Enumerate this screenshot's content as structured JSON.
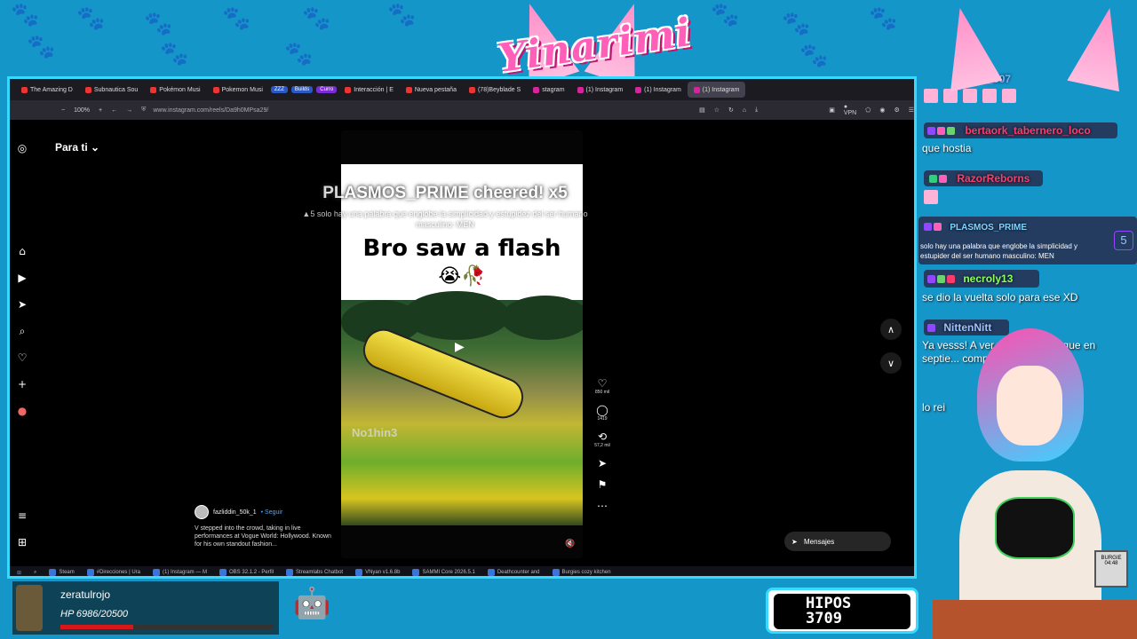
{
  "overlay": {
    "logo_text": "Yinarimi",
    "colors": {
      "background": "#1596c9",
      "frame": "#38d9ff",
      "pink": "#ff5fb8"
    }
  },
  "browser": {
    "tabs": [
      {
        "label": "The Amazing D",
        "active": false
      },
      {
        "label": "Subnautica Sou",
        "active": false
      },
      {
        "label": "Pokémon Musi",
        "active": false
      },
      {
        "label": "Pokemon Musi",
        "active": false
      },
      {
        "label": "ZZZ",
        "pill": true
      },
      {
        "label": "Builds",
        "pill": true
      },
      {
        "label": "Curro",
        "pill": true
      },
      {
        "label": "Interacción | E",
        "active": false
      },
      {
        "label": "Nueva pestaña",
        "active": false
      },
      {
        "label": "(78)Beyblade S",
        "active": false
      },
      {
        "label": "stagram",
        "active": false
      },
      {
        "label": "(1) Instagram",
        "active": false
      },
      {
        "label": "(1) Instagram",
        "active": false
      },
      {
        "label": "(1) Instagram",
        "active": true
      }
    ],
    "zoom": "100%",
    "url": "www.instagram.com/reels/Da9h0MPsa29/",
    "vpn_label": "VPN"
  },
  "instagram": {
    "feed_label": "Para ti",
    "reel": {
      "title": "Bro saw a flash",
      "emoji": "😭🥀",
      "watermark": "No1hin3"
    },
    "actions": [
      {
        "icon": "heart-icon",
        "glyph": "♡",
        "count": "850 mil"
      },
      {
        "icon": "comment-icon",
        "glyph": "◯",
        "count": "1419"
      },
      {
        "icon": "repost-icon",
        "glyph": "⟲",
        "count": "57,2 mil"
      },
      {
        "icon": "share-icon",
        "glyph": "➤",
        "count": ""
      },
      {
        "icon": "bookmark-icon",
        "glyph": "⚑",
        "count": ""
      },
      {
        "icon": "more-icon",
        "glyph": "⋯",
        "count": ""
      }
    ],
    "author": "fazliddin_50k_1",
    "follow_label": "• Seguir",
    "caption": "V stepped into the crowd, taking in live performances at Vogue World: Hollywood. Known for his own standout fashion...",
    "messages_label": "Mensajes"
  },
  "cheer_alert": {
    "title": "PLASMOS_PRIME cheered! x5",
    "amount": "5",
    "message": "solo hay una palabra que englobe la simplicidad y estupidez del ser humano masculino: MEN"
  },
  "taskbar": {
    "items": [
      "Steam",
      "#Direcciones | Ura",
      "(1) Instagram — M",
      "OBS 32.1.2 - Perfil",
      "Streamlabs Chatbot",
      "VNyan v1.6.8b",
      "SAMMI Core 2026.5.1",
      "Deathcounter and",
      "Burgies cozy kitchen"
    ]
  },
  "chat": {
    "messages": [
      {
        "user": "Alvaro_507",
        "text": "",
        "color": "#7fb0ff"
      },
      {
        "user": "bertaork_tabernero_loco",
        "text": "que hostia",
        "color": "#ff3b6b"
      },
      {
        "user": "RazorReborns",
        "text": "",
        "color": "#ff3b6b"
      },
      {
        "user": "PLASMOS_PRIME",
        "text": "solo hay una palabra que englobe la simplicidad y estupider del ser humano masculino: MEN",
        "color": "#7fd3ff",
        "bits": "5"
      },
      {
        "user": "necroly13",
        "text": "se dio la vuelta solo para ese XD",
        "color": "#8cff5a"
      },
      {
        "user": "NittenNitt",
        "text": "Ya vesss! A ver c... cae colab que en septie... complicar jajaja",
        "color": "#9fc2ff"
      },
      {
        "user": "",
        "text": "lo rei",
        "color": "#ffffff"
      }
    ]
  },
  "player": {
    "name": "zeratulrojo",
    "hp_text": "HP 6986/20500",
    "hp_fraction": 0.34
  },
  "hipos": {
    "label": "HIPOS",
    "count": "3709"
  },
  "burgie_label": "BURGIE",
  "clock": "04:48"
}
